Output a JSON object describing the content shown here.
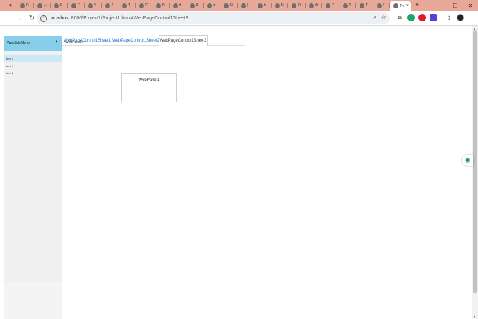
{
  "browser": {
    "tabs": [
      {
        "icon": "github-icon",
        "label": "D"
      },
      {
        "icon": "media-icon",
        "label": "—"
      },
      {
        "icon": "github-icon",
        "label": "P"
      },
      {
        "icon": "chrome-icon",
        "label": "C"
      },
      {
        "icon": "globe-icon",
        "label": "S"
      },
      {
        "icon": "page-icon",
        "label": "T"
      },
      {
        "icon": "github-icon",
        "label": "T"
      },
      {
        "icon": "page-icon",
        "label": "C"
      },
      {
        "icon": "chrome-icon",
        "label": "D"
      },
      {
        "icon": "firefox-icon",
        "label": "d"
      },
      {
        "icon": "bird-icon",
        "label": "R"
      },
      {
        "icon": "github-icon",
        "label": "in"
      },
      {
        "icon": "x-icon",
        "label": "Fi"
      },
      {
        "icon": "facebook-icon",
        "label": "("
      },
      {
        "icon": "github-icon",
        "label": "tr"
      },
      {
        "icon": "messenger-icon",
        "label": "M"
      },
      {
        "icon": "chrome-icon",
        "label": "O"
      },
      {
        "icon": "ms-icon",
        "label": "W"
      },
      {
        "icon": "facebook-icon",
        "label": "Z"
      },
      {
        "icon": "github-icon",
        "label": "T"
      },
      {
        "icon": "github-icon",
        "label": "T"
      },
      {
        "icon": "github-icon",
        "label": "T"
      }
    ],
    "active_tab": {
      "label": "Th",
      "close": "×"
    },
    "new_tab": "+",
    "window": {
      "minimize": "–",
      "maximize": "☐",
      "close": "✕"
    },
    "url": {
      "host": "localhost",
      "path": ":8000/Project1/Project1.html#WebPageControl1Sheet3"
    }
  },
  "app": {
    "side_menu": {
      "title": "WebSideMenu",
      "collapse_glyph": "‹",
      "items": [
        {
          "label": "Item 1",
          "selected": true
        },
        {
          "label": "Item 2",
          "selected": false
        },
        {
          "label": "Item 3",
          "selected": false
        }
      ]
    },
    "page_control": {
      "overlap_label": "WebPanel1",
      "tabs": [
        {
          "label": "WebPageControl1Sheet1",
          "active": false
        },
        {
          "label": "WebPageControl1Sheet2",
          "active": false
        },
        {
          "label": "WebPageControl1Sheet3",
          "active": true
        }
      ]
    },
    "panel": {
      "caption": "WebPanel1"
    }
  },
  "colors": {
    "tabstrip": "#e8a898",
    "side_menu_header": "#87ceeb",
    "link": "#1a6fd0"
  }
}
